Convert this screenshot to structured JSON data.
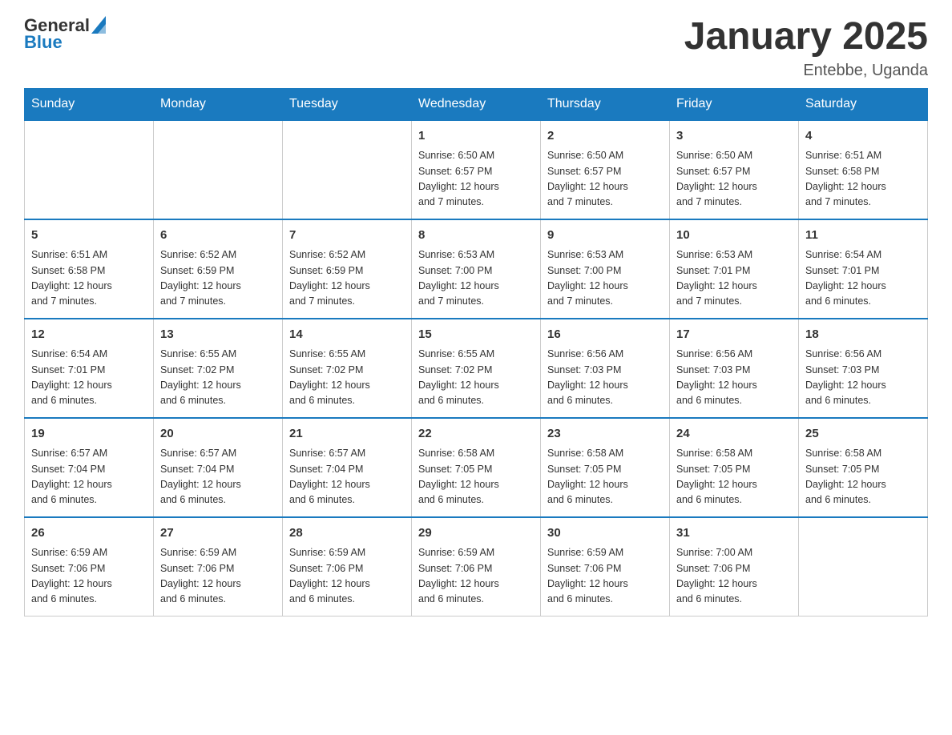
{
  "header": {
    "logo_general": "General",
    "logo_blue": "Blue",
    "title": "January 2025",
    "subtitle": "Entebbe, Uganda"
  },
  "days_of_week": [
    "Sunday",
    "Monday",
    "Tuesday",
    "Wednesday",
    "Thursday",
    "Friday",
    "Saturday"
  ],
  "weeks": [
    [
      {
        "day": "",
        "info": ""
      },
      {
        "day": "",
        "info": ""
      },
      {
        "day": "",
        "info": ""
      },
      {
        "day": "1",
        "info": "Sunrise: 6:50 AM\nSunset: 6:57 PM\nDaylight: 12 hours\nand 7 minutes."
      },
      {
        "day": "2",
        "info": "Sunrise: 6:50 AM\nSunset: 6:57 PM\nDaylight: 12 hours\nand 7 minutes."
      },
      {
        "day": "3",
        "info": "Sunrise: 6:50 AM\nSunset: 6:57 PM\nDaylight: 12 hours\nand 7 minutes."
      },
      {
        "day": "4",
        "info": "Sunrise: 6:51 AM\nSunset: 6:58 PM\nDaylight: 12 hours\nand 7 minutes."
      }
    ],
    [
      {
        "day": "5",
        "info": "Sunrise: 6:51 AM\nSunset: 6:58 PM\nDaylight: 12 hours\nand 7 minutes."
      },
      {
        "day": "6",
        "info": "Sunrise: 6:52 AM\nSunset: 6:59 PM\nDaylight: 12 hours\nand 7 minutes."
      },
      {
        "day": "7",
        "info": "Sunrise: 6:52 AM\nSunset: 6:59 PM\nDaylight: 12 hours\nand 7 minutes."
      },
      {
        "day": "8",
        "info": "Sunrise: 6:53 AM\nSunset: 7:00 PM\nDaylight: 12 hours\nand 7 minutes."
      },
      {
        "day": "9",
        "info": "Sunrise: 6:53 AM\nSunset: 7:00 PM\nDaylight: 12 hours\nand 7 minutes."
      },
      {
        "day": "10",
        "info": "Sunrise: 6:53 AM\nSunset: 7:01 PM\nDaylight: 12 hours\nand 7 minutes."
      },
      {
        "day": "11",
        "info": "Sunrise: 6:54 AM\nSunset: 7:01 PM\nDaylight: 12 hours\nand 6 minutes."
      }
    ],
    [
      {
        "day": "12",
        "info": "Sunrise: 6:54 AM\nSunset: 7:01 PM\nDaylight: 12 hours\nand 6 minutes."
      },
      {
        "day": "13",
        "info": "Sunrise: 6:55 AM\nSunset: 7:02 PM\nDaylight: 12 hours\nand 6 minutes."
      },
      {
        "day": "14",
        "info": "Sunrise: 6:55 AM\nSunset: 7:02 PM\nDaylight: 12 hours\nand 6 minutes."
      },
      {
        "day": "15",
        "info": "Sunrise: 6:55 AM\nSunset: 7:02 PM\nDaylight: 12 hours\nand 6 minutes."
      },
      {
        "day": "16",
        "info": "Sunrise: 6:56 AM\nSunset: 7:03 PM\nDaylight: 12 hours\nand 6 minutes."
      },
      {
        "day": "17",
        "info": "Sunrise: 6:56 AM\nSunset: 7:03 PM\nDaylight: 12 hours\nand 6 minutes."
      },
      {
        "day": "18",
        "info": "Sunrise: 6:56 AM\nSunset: 7:03 PM\nDaylight: 12 hours\nand 6 minutes."
      }
    ],
    [
      {
        "day": "19",
        "info": "Sunrise: 6:57 AM\nSunset: 7:04 PM\nDaylight: 12 hours\nand 6 minutes."
      },
      {
        "day": "20",
        "info": "Sunrise: 6:57 AM\nSunset: 7:04 PM\nDaylight: 12 hours\nand 6 minutes."
      },
      {
        "day": "21",
        "info": "Sunrise: 6:57 AM\nSunset: 7:04 PM\nDaylight: 12 hours\nand 6 minutes."
      },
      {
        "day": "22",
        "info": "Sunrise: 6:58 AM\nSunset: 7:05 PM\nDaylight: 12 hours\nand 6 minutes."
      },
      {
        "day": "23",
        "info": "Sunrise: 6:58 AM\nSunset: 7:05 PM\nDaylight: 12 hours\nand 6 minutes."
      },
      {
        "day": "24",
        "info": "Sunrise: 6:58 AM\nSunset: 7:05 PM\nDaylight: 12 hours\nand 6 minutes."
      },
      {
        "day": "25",
        "info": "Sunrise: 6:58 AM\nSunset: 7:05 PM\nDaylight: 12 hours\nand 6 minutes."
      }
    ],
    [
      {
        "day": "26",
        "info": "Sunrise: 6:59 AM\nSunset: 7:06 PM\nDaylight: 12 hours\nand 6 minutes."
      },
      {
        "day": "27",
        "info": "Sunrise: 6:59 AM\nSunset: 7:06 PM\nDaylight: 12 hours\nand 6 minutes."
      },
      {
        "day": "28",
        "info": "Sunrise: 6:59 AM\nSunset: 7:06 PM\nDaylight: 12 hours\nand 6 minutes."
      },
      {
        "day": "29",
        "info": "Sunrise: 6:59 AM\nSunset: 7:06 PM\nDaylight: 12 hours\nand 6 minutes."
      },
      {
        "day": "30",
        "info": "Sunrise: 6:59 AM\nSunset: 7:06 PM\nDaylight: 12 hours\nand 6 minutes."
      },
      {
        "day": "31",
        "info": "Sunrise: 7:00 AM\nSunset: 7:06 PM\nDaylight: 12 hours\nand 6 minutes."
      },
      {
        "day": "",
        "info": ""
      }
    ]
  ]
}
